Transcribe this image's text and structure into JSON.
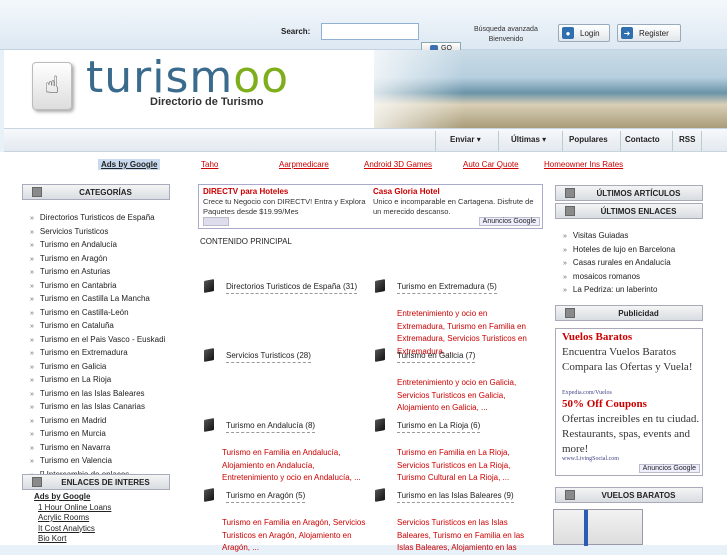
{
  "topbar": {
    "search_label": "Search:",
    "search_placeholder": "",
    "go_label": "GO",
    "advanced_search": "Búsqueda avanzada",
    "welcome": "Bienvenido",
    "login": "Login",
    "register": "Register"
  },
  "header": {
    "logo_left": "turism",
    "logo_o": "oo",
    "subtitle": "Directorio de Turismo"
  },
  "nav": {
    "enviar": "Enviar",
    "ultimas": "Últimas",
    "populares": "Populares",
    "contacto": "Contacto",
    "rss": "RSS"
  },
  "ads_bar": {
    "label": "Ads by Google",
    "links": [
      "Taho",
      "Aarpmedicare",
      "Android 3D Games",
      "Auto Car Quote",
      "Homeowner Ins Rates"
    ]
  },
  "left": {
    "categorias_title": "CATEGORÍAS",
    "categorias": [
      "Directorios Turisticos de España",
      "Servicios Turisticos",
      "Turismo en Andalucía",
      "Turismo en Aragón",
      "Turismo en Asturias",
      "Turismo en Cantabria",
      "Turismo en Castilla La Mancha",
      "Turismo en Castilla-León",
      "Turismo en Cataluña",
      "Turismo en el Pais Vasco - Euskadi",
      "Turismo en Extremadura",
      "Turismo en Galicia",
      "Turismo en La Rioja",
      "Turismo en las Islas Baleares",
      "Turismo en las Islas Canarias",
      "Turismo en Madrid",
      "Turismo en Murcia",
      "Turismo en Navarra",
      "Turismo en Valencia",
      "[] Intercambio de enlaces"
    ],
    "enlaces_title": "ENLACES DE INTERES",
    "ads_by_google": "Ads by Google",
    "enlaces": [
      "1 Hour Online Loans",
      "Acrylic Rooms",
      "It Cost Analytics",
      "Bio Kort"
    ]
  },
  "adbox": {
    "ad1_title": "DIRECTV para Hoteles",
    "ad1_desc": "Crece tu Negocio con DIRECTV! Entra y Explora Paquetes desde $19.99/Mes",
    "ad2_title": "Casa Gloria Hotel",
    "ad2_desc": "Unico e incomparable en Cartagena. Disfrute de un merecido descanso.",
    "badge": "Anuncios Google"
  },
  "main": {
    "contenido": "CONTENIDO PRINCIPAL",
    "dirs": [
      {
        "title": "Directorios Turisticos de España (31)",
        "links": ""
      },
      {
        "title": "Turismo en Extremadura (5)",
        "links": "Entretenimiento y ocio en Extremadura, Turismo en Familia en Extremadura, Servicios Turisticos en Extremadura, ..."
      },
      {
        "title": "Servicios Turisticos (28)",
        "links": ""
      },
      {
        "title": "Turismo en Galicia (7)",
        "links": "Entretenimiento y ocio en Galicia, Servicios Turisticos en Galicia, Alojamiento en Galicia, ..."
      },
      {
        "title": "Turismo en Andalucía (8)",
        "links": "Turismo en Familia en Andalucía, Alojamiento en Andalucía, Entretenimiento y ocio en Andalucía, ..."
      },
      {
        "title": "Turismo en La Rioja (6)",
        "links": "Turismo en Familia en La Rioja, Servicios Turisticos en La Rioja, Turismo Cultural en La Rioja, ..."
      },
      {
        "title": "Turismo en Aragón (5)",
        "links": "Turismo en Familia en Aragón, Servicios Turisticos en Aragón, Alojamiento en Aragón, ..."
      },
      {
        "title": "Turismo en las Islas Baleares (9)",
        "links": "Servicios Turisticos en las Islas Baleares, Turismo en Familia en las Islas Baleares, Alojamiento en las"
      }
    ]
  },
  "right": {
    "articulos_title": "ÚLTIMOS ARTÍCULOS",
    "enlaces_title": "ÚLTIMOS ENLACES",
    "enlaces": [
      "Visitas Guiadas",
      "Hoteles de lujo en Barcelona",
      "Casas rurales en Andalucía",
      "mosaicos romanos",
      "La Pedriza: un laberinto"
    ],
    "publicidad_title": "Publicidad",
    "pub": {
      "h1": "Vuelos Baratos",
      "d1": "Encuentra Vuelos Baratos Compara las Ofertas y Vuela!",
      "u1": "Expedia.com/Vuelos",
      "h2": "50% Off Coupons",
      "d2": "Ofertas increibles en tu ciudad. Restaurants, spas, events and more!",
      "u2": "www.LivingSocial.com",
      "badge": "Anuncios Google"
    },
    "vuelos_title": "VUELOS BARATOS"
  }
}
